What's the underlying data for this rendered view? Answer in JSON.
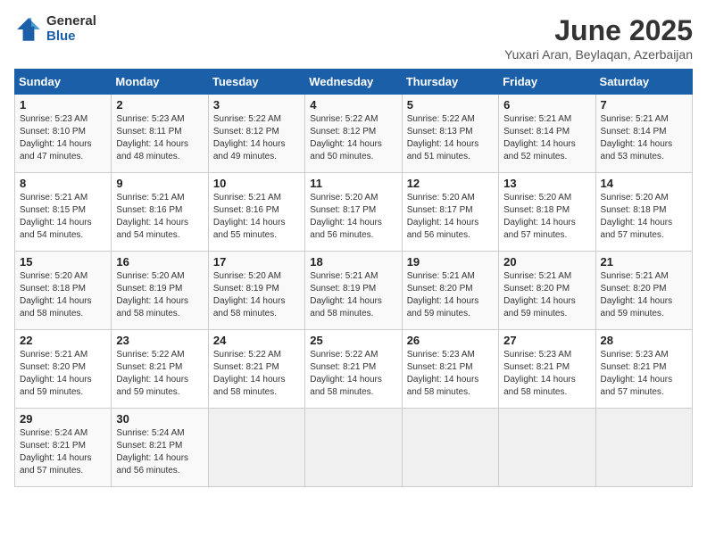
{
  "header": {
    "logo_general": "General",
    "logo_blue": "Blue",
    "title": "June 2025",
    "subtitle": "Yuxari Aran, Beylaqan, Azerbaijan"
  },
  "weekdays": [
    "Sunday",
    "Monday",
    "Tuesday",
    "Wednesday",
    "Thursday",
    "Friday",
    "Saturday"
  ],
  "weeks": [
    [
      {
        "day": "1",
        "sunrise": "5:23 AM",
        "sunset": "8:10 PM",
        "daylight": "14 hours and 47 minutes."
      },
      {
        "day": "2",
        "sunrise": "5:23 AM",
        "sunset": "8:11 PM",
        "daylight": "14 hours and 48 minutes."
      },
      {
        "day": "3",
        "sunrise": "5:22 AM",
        "sunset": "8:12 PM",
        "daylight": "14 hours and 49 minutes."
      },
      {
        "day": "4",
        "sunrise": "5:22 AM",
        "sunset": "8:12 PM",
        "daylight": "14 hours and 50 minutes."
      },
      {
        "day": "5",
        "sunrise": "5:22 AM",
        "sunset": "8:13 PM",
        "daylight": "14 hours and 51 minutes."
      },
      {
        "day": "6",
        "sunrise": "5:21 AM",
        "sunset": "8:14 PM",
        "daylight": "14 hours and 52 minutes."
      },
      {
        "day": "7",
        "sunrise": "5:21 AM",
        "sunset": "8:14 PM",
        "daylight": "14 hours and 53 minutes."
      }
    ],
    [
      {
        "day": "8",
        "sunrise": "5:21 AM",
        "sunset": "8:15 PM",
        "daylight": "14 hours and 54 minutes."
      },
      {
        "day": "9",
        "sunrise": "5:21 AM",
        "sunset": "8:16 PM",
        "daylight": "14 hours and 54 minutes."
      },
      {
        "day": "10",
        "sunrise": "5:21 AM",
        "sunset": "8:16 PM",
        "daylight": "14 hours and 55 minutes."
      },
      {
        "day": "11",
        "sunrise": "5:20 AM",
        "sunset": "8:17 PM",
        "daylight": "14 hours and 56 minutes."
      },
      {
        "day": "12",
        "sunrise": "5:20 AM",
        "sunset": "8:17 PM",
        "daylight": "14 hours and 56 minutes."
      },
      {
        "day": "13",
        "sunrise": "5:20 AM",
        "sunset": "8:18 PM",
        "daylight": "14 hours and 57 minutes."
      },
      {
        "day": "14",
        "sunrise": "5:20 AM",
        "sunset": "8:18 PM",
        "daylight": "14 hours and 57 minutes."
      }
    ],
    [
      {
        "day": "15",
        "sunrise": "5:20 AM",
        "sunset": "8:18 PM",
        "daylight": "14 hours and 58 minutes."
      },
      {
        "day": "16",
        "sunrise": "5:20 AM",
        "sunset": "8:19 PM",
        "daylight": "14 hours and 58 minutes."
      },
      {
        "day": "17",
        "sunrise": "5:20 AM",
        "sunset": "8:19 PM",
        "daylight": "14 hours and 58 minutes."
      },
      {
        "day": "18",
        "sunrise": "5:21 AM",
        "sunset": "8:19 PM",
        "daylight": "14 hours and 58 minutes."
      },
      {
        "day": "19",
        "sunrise": "5:21 AM",
        "sunset": "8:20 PM",
        "daylight": "14 hours and 59 minutes."
      },
      {
        "day": "20",
        "sunrise": "5:21 AM",
        "sunset": "8:20 PM",
        "daylight": "14 hours and 59 minutes."
      },
      {
        "day": "21",
        "sunrise": "5:21 AM",
        "sunset": "8:20 PM",
        "daylight": "14 hours and 59 minutes."
      }
    ],
    [
      {
        "day": "22",
        "sunrise": "5:21 AM",
        "sunset": "8:20 PM",
        "daylight": "14 hours and 59 minutes."
      },
      {
        "day": "23",
        "sunrise": "5:22 AM",
        "sunset": "8:21 PM",
        "daylight": "14 hours and 59 minutes."
      },
      {
        "day": "24",
        "sunrise": "5:22 AM",
        "sunset": "8:21 PM",
        "daylight": "14 hours and 58 minutes."
      },
      {
        "day": "25",
        "sunrise": "5:22 AM",
        "sunset": "8:21 PM",
        "daylight": "14 hours and 58 minutes."
      },
      {
        "day": "26",
        "sunrise": "5:23 AM",
        "sunset": "8:21 PM",
        "daylight": "14 hours and 58 minutes."
      },
      {
        "day": "27",
        "sunrise": "5:23 AM",
        "sunset": "8:21 PM",
        "daylight": "14 hours and 58 minutes."
      },
      {
        "day": "28",
        "sunrise": "5:23 AM",
        "sunset": "8:21 PM",
        "daylight": "14 hours and 57 minutes."
      }
    ],
    [
      {
        "day": "29",
        "sunrise": "5:24 AM",
        "sunset": "8:21 PM",
        "daylight": "14 hours and 57 minutes."
      },
      {
        "day": "30",
        "sunrise": "5:24 AM",
        "sunset": "8:21 PM",
        "daylight": "14 hours and 56 minutes."
      },
      null,
      null,
      null,
      null,
      null
    ]
  ]
}
